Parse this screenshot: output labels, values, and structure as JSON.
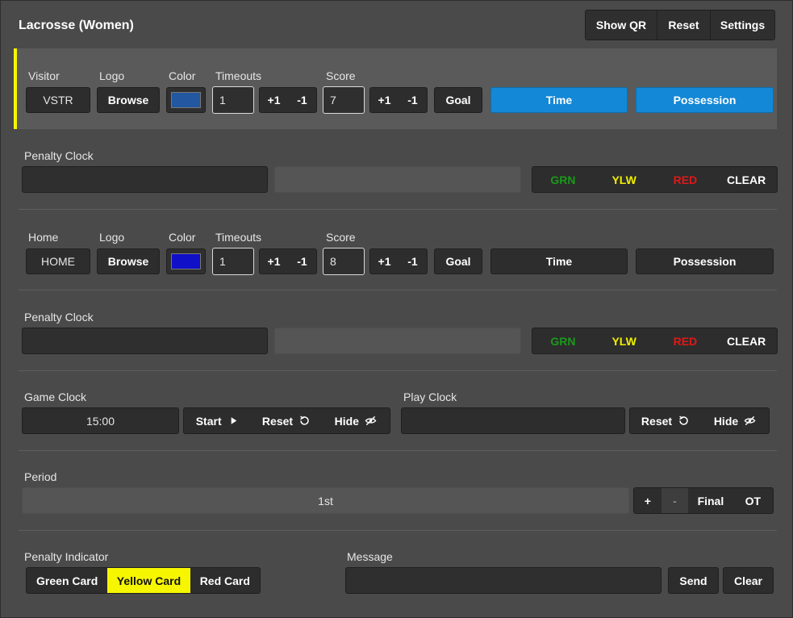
{
  "app": {
    "title": "Lacrosse (Women)"
  },
  "toolbar": {
    "show_qr": "Show QR",
    "reset": "Reset",
    "settings": "Settings"
  },
  "visitor": {
    "section_label": "Visitor",
    "name": "VSTR",
    "logo_label": "Logo",
    "browse": "Browse",
    "color_label": "Color",
    "color": "#2358a0",
    "timeouts_label": "Timeouts",
    "timeouts": "1",
    "score_label": "Score",
    "score": "7",
    "plus": "+1",
    "minus": "-1",
    "goal": "Goal",
    "time": "Time",
    "possession": "Possession"
  },
  "visitor_penalty": {
    "label": "Penalty Clock",
    "grn": "GRN",
    "ylw": "YLW",
    "red": "RED",
    "clear": "CLEAR"
  },
  "home": {
    "section_label": "Home",
    "name": "HOME",
    "logo_label": "Logo",
    "browse": "Browse",
    "color_label": "Color",
    "color": "#1010c8",
    "timeouts_label": "Timeouts",
    "timeouts": "1",
    "score_label": "Score",
    "score": "8",
    "plus": "+1",
    "minus": "-1",
    "goal": "Goal",
    "time": "Time",
    "possession": "Possession"
  },
  "home_penalty": {
    "label": "Penalty Clock",
    "grn": "GRN",
    "ylw": "YLW",
    "red": "RED",
    "clear": "CLEAR"
  },
  "game_clock": {
    "label": "Game Clock",
    "value": "15:00",
    "start": "Start",
    "reset": "Reset",
    "hide": "Hide"
  },
  "play_clock": {
    "label": "Play Clock",
    "value": "",
    "reset": "Reset",
    "hide": "Hide"
  },
  "period": {
    "label": "Period",
    "value": "1st",
    "plus": "+",
    "minus": "-",
    "final": "Final",
    "ot": "OT"
  },
  "penalty_indicator": {
    "label": "Penalty Indicator",
    "green": "Green Card",
    "yellow": "Yellow Card",
    "red": "Red Card"
  },
  "message": {
    "label": "Message",
    "value": "",
    "send": "Send",
    "clear": "Clear"
  },
  "colors": {
    "accent_blue": "#1388d6",
    "highlight_yellow": "#f6f600",
    "grn": "#1a9a1a",
    "ylw": "#f0f000",
    "red": "#e01818"
  }
}
